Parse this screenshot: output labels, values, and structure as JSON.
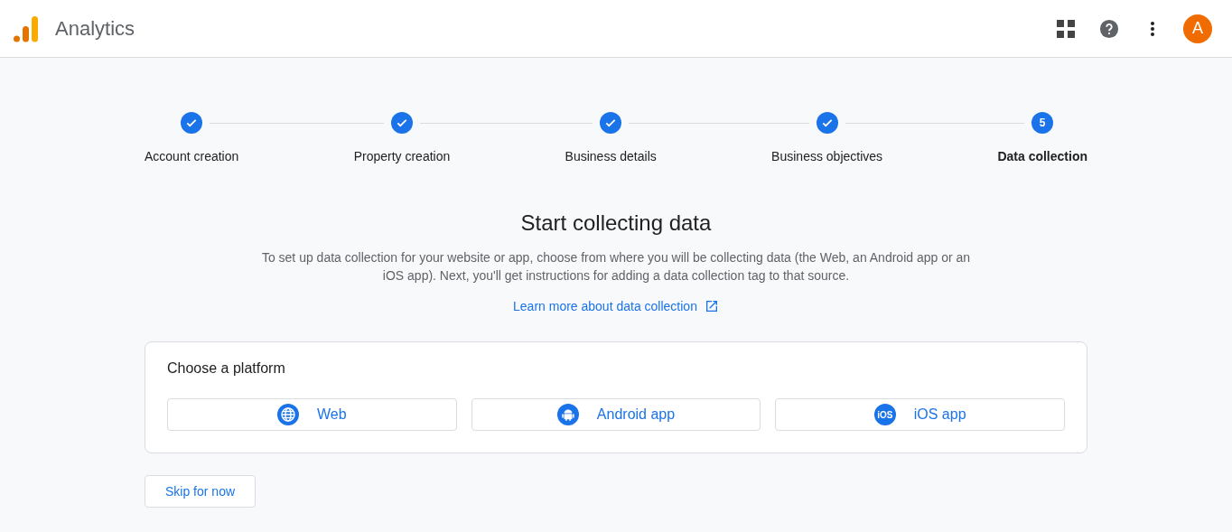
{
  "header": {
    "title": "Analytics",
    "avatar": "A"
  },
  "steps": [
    {
      "label": "Account creation",
      "completed": true,
      "selected": false
    },
    {
      "label": "Property creation",
      "completed": true,
      "selected": false
    },
    {
      "label": "Business details",
      "completed": true,
      "selected": false
    },
    {
      "label": "Business objectives",
      "completed": true,
      "selected": false
    },
    {
      "label": "Data collection",
      "completed": false,
      "selected": true,
      "number": "5"
    }
  ],
  "heading": "Start collecting data",
  "description": "To set up data collection for your website or app, choose from where you will be collecting data (the Web, an Android app or an iOS app). Next, you'll get instructions for adding a data collection tag to that source.",
  "link": "Learn more about data collection",
  "platform_card": {
    "title": "Choose a platform",
    "platforms": [
      {
        "kind": "web",
        "label": "Web"
      },
      {
        "kind": "android",
        "label": "Android app"
      },
      {
        "kind": "ios",
        "label": "iOS app",
        "icon_text": "iOS"
      }
    ]
  },
  "skip_button": "Skip for now"
}
